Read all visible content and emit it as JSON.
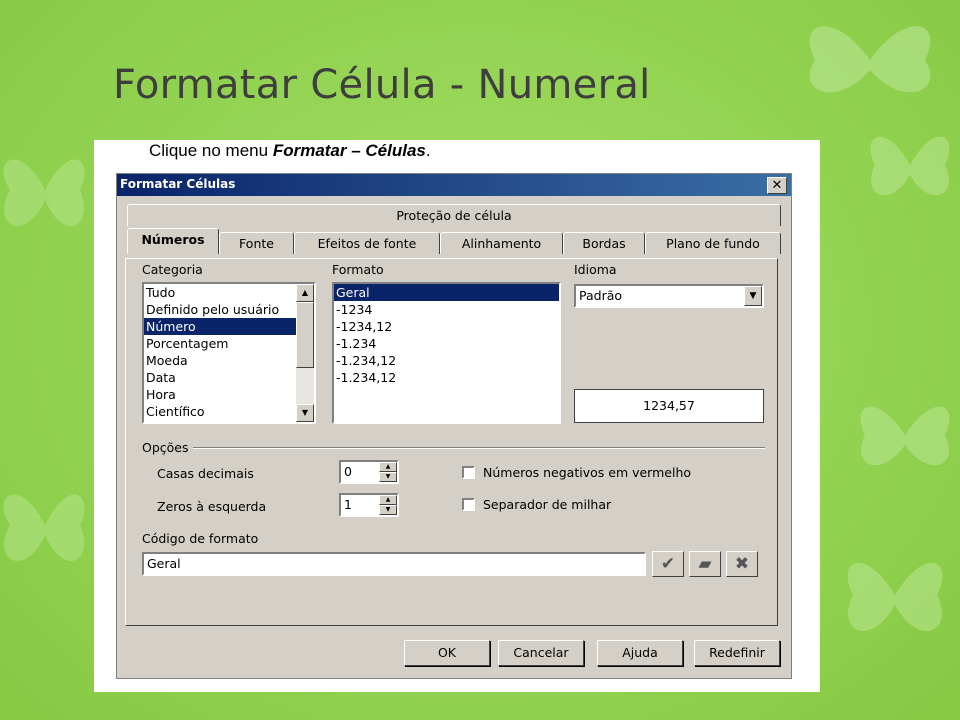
{
  "slide": {
    "title": "Formatar Célula - Numeral",
    "instruction_prefix": "Clique no menu ",
    "instruction_menu": "Formatar – Células",
    "instruction_suffix": "."
  },
  "dialog": {
    "title": "Formatar Células",
    "close_label": "✕",
    "tabs_row1": [
      "Proteção de célula"
    ],
    "tabs_row2": [
      "Números",
      "Fonte",
      "Efeitos de fonte",
      "Alinhamento",
      "Bordas",
      "Plano de fundo"
    ],
    "active_tab": "Números",
    "category": {
      "label": "Categoria",
      "items": [
        "Tudo",
        "Definido pelo usuário",
        "Número",
        "Porcentagem",
        "Moeda",
        "Data",
        "Hora",
        "Científico"
      ],
      "selected": "Número"
    },
    "format": {
      "label": "Formato",
      "items": [
        "Geral",
        "-1234",
        "-1234,12",
        "-1.234",
        "-1.234,12",
        "-1.234,12"
      ],
      "selected": "Geral"
    },
    "language": {
      "label": "Idioma",
      "value": "Padrão"
    },
    "preview_value": "1234,57",
    "options": {
      "label": "Opções",
      "decimal_places_label": "Casas decimais",
      "decimal_places_value": "0",
      "leading_zeros_label": "Zeros à esquerda",
      "leading_zeros_value": "1",
      "negative_red_label": "Números negativos em vermelho",
      "negative_red_checked": false,
      "thousands_sep_label": "Separador de milhar",
      "thousands_sep_checked": false
    },
    "format_code": {
      "label": "Código de formato",
      "value": "Geral"
    },
    "buttons": {
      "ok": "OK",
      "cancel": "Cancelar",
      "help": "Ajuda",
      "reset": "Redefinir"
    }
  },
  "colors": {
    "background": "#8fd14f",
    "selection": "#0a246a",
    "dialog_face": "#d4d0c8"
  }
}
